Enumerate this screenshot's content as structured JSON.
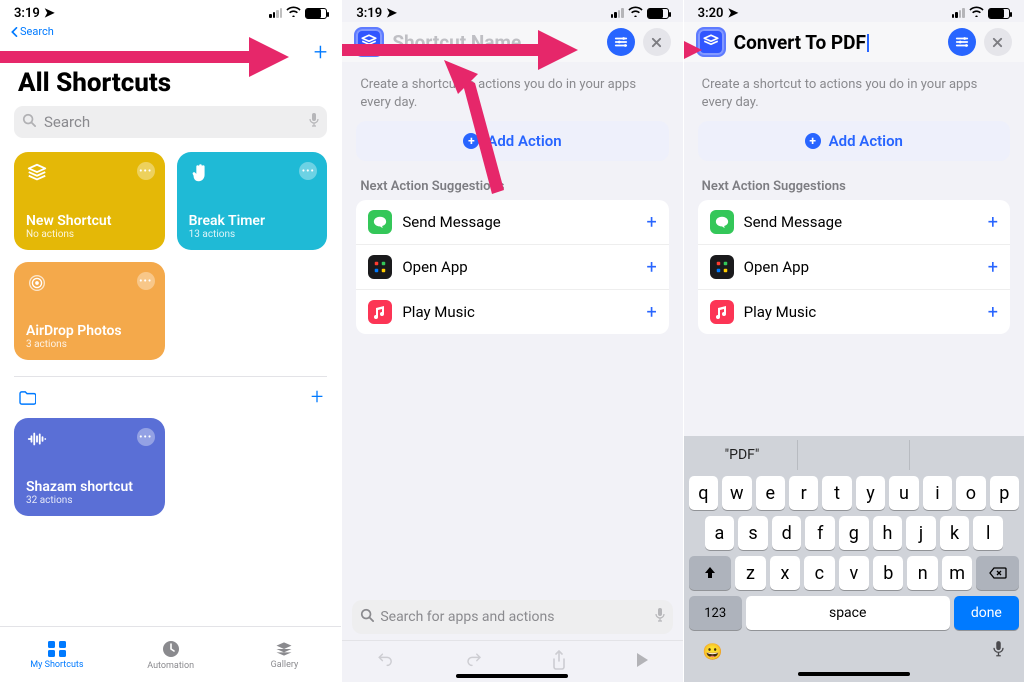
{
  "panel1": {
    "status": {
      "time": "3:19",
      "back_label": "Search"
    },
    "title": "All Shortcuts",
    "search_placeholder": "Search",
    "tiles": [
      {
        "name": "New Shortcut",
        "sub": "No actions",
        "color": "t-yellow",
        "icon": "layers"
      },
      {
        "name": "Break Timer",
        "sub": "13 actions",
        "color": "t-teal",
        "icon": "hand"
      },
      {
        "name": "AirDrop Photos",
        "sub": "3 actions",
        "color": "t-orange",
        "icon": "airdrop"
      },
      {
        "name": "Shazam shortcut",
        "sub": "32 actions",
        "color": "t-blue",
        "icon": "wave",
        "section": 2
      }
    ],
    "tabs": [
      {
        "label": "My Shortcuts",
        "icon": "grid",
        "active": true
      },
      {
        "label": "Automation",
        "icon": "clock",
        "active": false
      },
      {
        "label": "Gallery",
        "icon": "layers",
        "active": false
      }
    ]
  },
  "panel2": {
    "status": {
      "time": "3:19"
    },
    "name_placeholder": "Shortcut Name",
    "subtext": "Create a shortcut to actions you do in your apps every day.",
    "add_action_label": "Add Action",
    "suggestions_label": "Next Action Suggestions",
    "suggestions": [
      {
        "label": "Send Message",
        "icon": "a-msg"
      },
      {
        "label": "Open App",
        "icon": "a-open"
      },
      {
        "label": "Play Music",
        "icon": "a-music"
      }
    ],
    "search_placeholder": "Search for apps and actions"
  },
  "panel3": {
    "status": {
      "time": "3:20"
    },
    "name_value": "Convert To PDF",
    "subtext": "Create a shortcut to actions you do in your apps every day.",
    "add_action_label": "Add Action",
    "suggestions_label": "Next Action Suggestions",
    "suggestions": [
      {
        "label": "Send Message",
        "icon": "a-msg"
      },
      {
        "label": "Open App",
        "icon": "a-open"
      },
      {
        "label": "Play Music",
        "icon": "a-music"
      }
    ],
    "keyboard": {
      "suggestion": "\"PDF\"",
      "row1": [
        "q",
        "w",
        "e",
        "r",
        "t",
        "y",
        "u",
        "i",
        "o",
        "p"
      ],
      "row2": [
        "a",
        "s",
        "d",
        "f",
        "g",
        "h",
        "j",
        "k",
        "l"
      ],
      "row3": [
        "z",
        "x",
        "c",
        "v",
        "b",
        "n",
        "m"
      ],
      "num_key": "123",
      "space_key": "space",
      "done_key": "done"
    }
  }
}
